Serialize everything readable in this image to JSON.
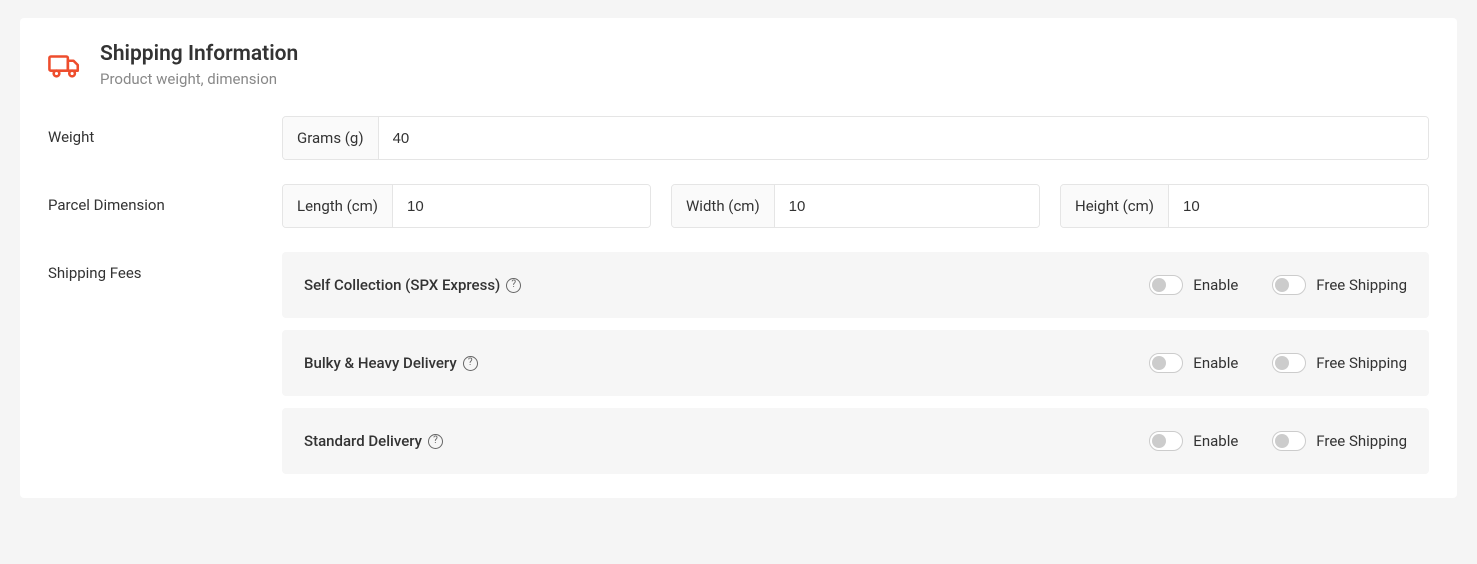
{
  "header": {
    "title": "Shipping Information",
    "subtitle": "Product weight, dimension"
  },
  "weight": {
    "label": "Weight",
    "unit_label": "Grams (g)",
    "value": "40"
  },
  "dimension": {
    "label": "Parcel Dimension",
    "length_label": "Length (cm)",
    "length_value": "10",
    "width_label": "Width (cm)",
    "width_value": "10",
    "height_label": "Height (cm)",
    "height_value": "10"
  },
  "shipping_fees": {
    "label": "Shipping Fees",
    "enable_label": "Enable",
    "free_label": "Free Shipping",
    "options": [
      {
        "name": "Self Collection (SPX Express)",
        "enabled": false,
        "free_shipping": false
      },
      {
        "name": "Bulky & Heavy Delivery",
        "enabled": false,
        "free_shipping": false
      },
      {
        "name": "Standard Delivery",
        "enabled": false,
        "free_shipping": false
      }
    ]
  }
}
